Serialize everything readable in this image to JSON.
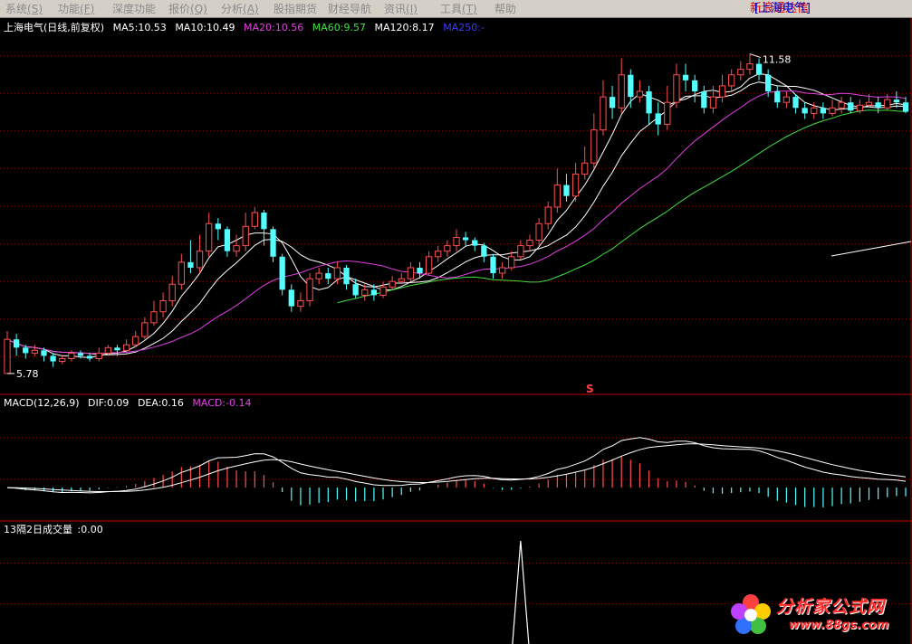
{
  "menu": [
    {
      "label": "系统",
      "key": "(S)"
    },
    {
      "label": "功能",
      "key": "(F)"
    },
    {
      "label": "深度功能",
      "key": ""
    },
    {
      "label": "报价",
      "key": "(Q)"
    },
    {
      "label": "分析",
      "key": "(A)"
    },
    {
      "label": "股指期货",
      "key": ""
    },
    {
      "label": "财经导航",
      "key": ""
    },
    {
      "label": "资讯",
      "key": "(I)"
    },
    {
      "label": "工具",
      "key": "(T)"
    },
    {
      "label": "帮助",
      "key": ""
    }
  ],
  "brand": {
    "app": "新浪通达信",
    "stock": "[上海电气]"
  },
  "main_legend": {
    "title": "上海电气(日线,前复权)",
    "items": [
      {
        "text": "MA5:10.53",
        "color": "#ffffff"
      },
      {
        "text": "MA10:10.49",
        "color": "#ffffff"
      },
      {
        "text": "MA20:10.56",
        "color": "#e040e0"
      },
      {
        "text": "MA60:9.57",
        "color": "#40e040"
      },
      {
        "text": "MA120:8.17",
        "color": "#ffffff"
      },
      {
        "text": "MA250:-",
        "color": "#3a3aff"
      }
    ]
  },
  "macd_legend": {
    "title": "MACD(12,26,9)",
    "items": [
      {
        "text": "DIF:0.09",
        "color": "#ffffff"
      },
      {
        "text": "DEA:0.16",
        "color": "#ffffff"
      },
      {
        "text": "MACD:-0.14",
        "color": "#e040e0"
      }
    ]
  },
  "vol_legend": {
    "title": "13隔2日成交量",
    "value": ":0.00"
  },
  "annotations": {
    "high_label": "11.58",
    "low_label": "5.78",
    "marker": "S"
  },
  "watermark": {
    "text": "分析家公式网",
    "url": "www.88gs.com"
  },
  "colors": {
    "up": "#ff5050",
    "down": "#54ffff",
    "grid": "#8b0000",
    "ma5": "#ffffff",
    "ma20": "#e040e0",
    "ma60": "#40e040",
    "ma120": "#ffffff"
  },
  "chart_data": {
    "type": "candlestick",
    "price_range": [
      5.5,
      12.0
    ],
    "candles": [
      [
        5.78,
        6.4,
        6.55,
        5.78
      ],
      [
        6.4,
        6.25,
        6.5,
        6.1
      ],
      [
        6.25,
        6.15,
        6.3,
        6.05
      ],
      [
        6.15,
        6.2,
        6.3,
        6.1
      ],
      [
        6.2,
        6.1,
        6.25,
        6.0
      ],
      [
        6.1,
        6.0,
        6.15,
        5.9
      ],
      [
        6.0,
        6.05,
        6.1,
        5.95
      ],
      [
        6.05,
        6.15,
        6.2,
        6.0
      ],
      [
        6.15,
        6.1,
        6.2,
        6.05
      ],
      [
        6.1,
        6.05,
        6.15,
        6.0
      ],
      [
        6.05,
        6.15,
        6.25,
        6.0
      ],
      [
        6.15,
        6.25,
        6.3,
        6.1
      ],
      [
        6.25,
        6.2,
        6.3,
        6.1
      ],
      [
        6.2,
        6.3,
        6.4,
        6.15
      ],
      [
        6.3,
        6.45,
        6.55,
        6.25
      ],
      [
        6.45,
        6.7,
        6.8,
        6.4
      ],
      [
        6.7,
        6.9,
        7.1,
        6.65
      ],
      [
        6.9,
        7.1,
        7.25,
        6.8
      ],
      [
        7.1,
        7.4,
        7.55,
        7.0
      ],
      [
        7.4,
        7.8,
        7.95,
        7.3
      ],
      [
        7.8,
        7.7,
        8.2,
        7.6
      ],
      [
        7.7,
        8.0,
        8.3,
        7.6
      ],
      [
        8.0,
        8.5,
        8.7,
        7.9
      ],
      [
        8.5,
        8.4,
        8.6,
        8.2
      ],
      [
        8.4,
        8.0,
        8.45,
        7.9
      ],
      [
        8.0,
        8.1,
        8.3,
        7.9
      ],
      [
        8.1,
        8.45,
        8.7,
        8.0
      ],
      [
        8.45,
        8.7,
        8.8,
        8.4
      ],
      [
        8.7,
        8.4,
        8.75,
        8.1
      ],
      [
        8.4,
        7.9,
        8.45,
        7.8
      ],
      [
        7.9,
        7.3,
        7.95,
        7.2
      ],
      [
        7.3,
        7.0,
        7.4,
        6.9
      ],
      [
        7.0,
        7.1,
        7.25,
        6.9
      ],
      [
        7.1,
        7.5,
        7.6,
        7.0
      ],
      [
        7.5,
        7.6,
        7.7,
        7.4
      ],
      [
        7.6,
        7.5,
        7.7,
        7.4
      ],
      [
        7.5,
        7.7,
        7.8,
        7.4
      ],
      [
        7.7,
        7.4,
        7.75,
        7.3
      ],
      [
        7.4,
        7.2,
        7.5,
        7.15
      ],
      [
        7.2,
        7.3,
        7.4,
        7.1
      ],
      [
        7.3,
        7.2,
        7.4,
        7.1
      ],
      [
        7.2,
        7.35,
        7.45,
        7.15
      ],
      [
        7.35,
        7.45,
        7.55,
        7.3
      ],
      [
        7.45,
        7.5,
        7.6,
        7.4
      ],
      [
        7.5,
        7.7,
        7.8,
        7.45
      ],
      [
        7.7,
        7.6,
        7.8,
        7.5
      ],
      [
        7.6,
        7.9,
        8.0,
        7.55
      ],
      [
        7.9,
        8.0,
        8.1,
        7.8
      ],
      [
        8.0,
        8.1,
        8.2,
        7.9
      ],
      [
        8.1,
        8.25,
        8.4,
        8.0
      ],
      [
        8.25,
        8.2,
        8.35,
        8.1
      ],
      [
        8.2,
        8.1,
        8.25,
        8.0
      ],
      [
        8.1,
        7.9,
        8.15,
        7.8
      ],
      [
        7.9,
        7.6,
        7.95,
        7.5
      ],
      [
        7.6,
        7.7,
        7.8,
        7.5
      ],
      [
        7.7,
        7.9,
        8.0,
        7.65
      ],
      [
        7.9,
        8.1,
        8.2,
        7.85
      ],
      [
        8.1,
        8.2,
        8.3,
        8.0
      ],
      [
        8.2,
        8.5,
        8.6,
        8.1
      ],
      [
        8.5,
        8.8,
        8.9,
        8.4
      ],
      [
        8.8,
        9.2,
        9.5,
        8.7
      ],
      [
        9.2,
        9.0,
        9.4,
        8.9
      ],
      [
        9.0,
        9.4,
        9.6,
        8.9
      ],
      [
        9.4,
        9.6,
        9.9,
        9.3
      ],
      [
        9.6,
        10.2,
        10.5,
        9.5
      ],
      [
        10.2,
        10.8,
        11.1,
        10.1
      ],
      [
        10.8,
        10.6,
        11.0,
        10.4
      ],
      [
        10.6,
        11.2,
        11.5,
        10.5
      ],
      [
        11.2,
        10.8,
        11.3,
        10.6
      ],
      [
        10.8,
        10.9,
        11.1,
        10.7
      ],
      [
        10.9,
        10.5,
        11.0,
        10.3
      ],
      [
        10.5,
        10.3,
        10.7,
        10.1
      ],
      [
        10.3,
        10.7,
        11.0,
        10.2
      ],
      [
        10.7,
        11.2,
        11.4,
        10.6
      ],
      [
        11.2,
        11.1,
        11.4,
        10.9
      ],
      [
        11.1,
        10.9,
        11.2,
        10.7
      ],
      [
        10.9,
        10.6,
        11.0,
        10.5
      ],
      [
        10.6,
        10.8,
        11.0,
        10.5
      ],
      [
        10.8,
        11.0,
        11.2,
        10.7
      ],
      [
        11.0,
        11.2,
        11.3,
        10.9
      ],
      [
        11.2,
        11.3,
        11.45,
        11.1
      ],
      [
        11.3,
        11.4,
        11.58,
        11.2
      ],
      [
        11.4,
        11.2,
        11.5,
        11.1
      ],
      [
        11.2,
        10.9,
        11.3,
        10.8
      ],
      [
        10.9,
        10.7,
        11.0,
        10.6
      ],
      [
        10.7,
        10.8,
        10.9,
        10.6
      ],
      [
        10.8,
        10.6,
        10.85,
        10.5
      ],
      [
        10.6,
        10.5,
        10.7,
        10.4
      ],
      [
        10.5,
        10.6,
        10.7,
        10.4
      ],
      [
        10.6,
        10.5,
        10.7,
        10.4
      ],
      [
        10.5,
        10.6,
        10.75,
        10.45
      ],
      [
        10.6,
        10.7,
        10.8,
        10.5
      ],
      [
        10.7,
        10.55,
        10.8,
        10.5
      ],
      [
        10.55,
        10.65,
        10.75,
        10.5
      ],
      [
        10.65,
        10.7,
        10.85,
        10.6
      ],
      [
        10.7,
        10.6,
        10.8,
        10.5
      ],
      [
        10.6,
        10.75,
        10.85,
        10.55
      ],
      [
        10.75,
        10.7,
        10.9,
        10.6
      ],
      [
        10.7,
        10.53,
        10.8,
        10.5
      ]
    ],
    "macd_range": [
      -0.5,
      1.2
    ],
    "volume_spike_index": 56
  }
}
